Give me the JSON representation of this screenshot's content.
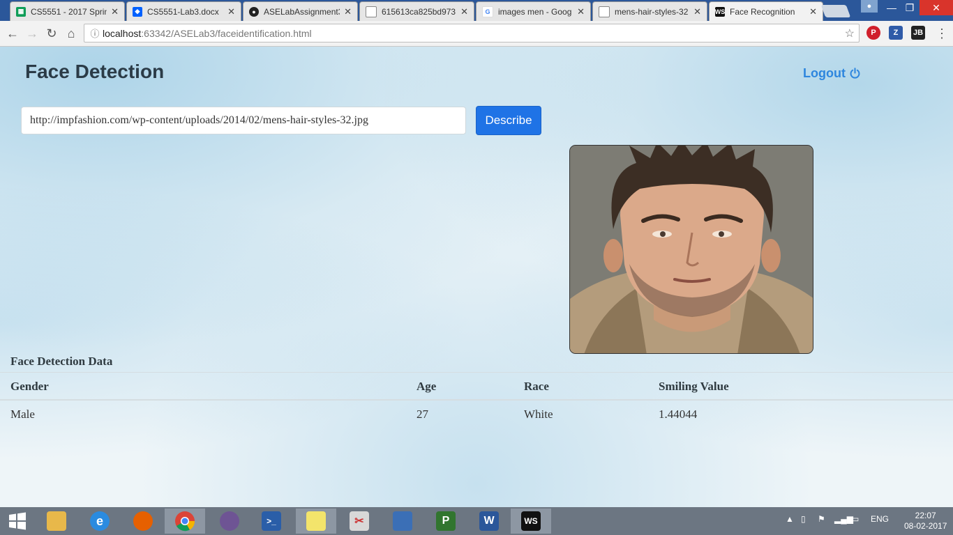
{
  "browser": {
    "tabs": [
      {
        "title": "CS5551 - 2017 Sprin",
        "icon": "sheets-icon"
      },
      {
        "title": "CS5551-Lab3.docx",
        "icon": "dropbox-icon"
      },
      {
        "title": "ASELabAssignment3",
        "icon": "github-icon"
      },
      {
        "title": "615613ca825bd973",
        "icon": "document-icon"
      },
      {
        "title": "images men - Goog",
        "icon": "google-icon"
      },
      {
        "title": "mens-hair-styles-32",
        "icon": "document-icon"
      },
      {
        "title": "Face Recognition",
        "icon": "webstorm-icon"
      }
    ],
    "address": {
      "host": "localhost",
      "path": ":63342/ASELab3/faceidentification.html"
    },
    "extensions": [
      {
        "label": "P",
        "color": "#d01f2b"
      },
      {
        "label": "Z",
        "color": "#2f5ba8"
      },
      {
        "label": "JB",
        "color": "#222222"
      }
    ]
  },
  "app": {
    "title": "Face Detection",
    "logout_label": "Logout",
    "url_value": "http://impfashion.com/wp-content/uploads/2014/02/mens-hair-styles-32.jpg",
    "describe_label": "Describe",
    "section_title": "Face Detection Data",
    "table": {
      "headers": [
        "Gender",
        "Age",
        "Race",
        "Smiling Value"
      ],
      "rows": [
        [
          "Male",
          "27",
          "White",
          "1.44044"
        ]
      ]
    }
  },
  "taskbar": {
    "tray_language": "ENG",
    "time": "22:07",
    "date": "08-02-2017"
  }
}
